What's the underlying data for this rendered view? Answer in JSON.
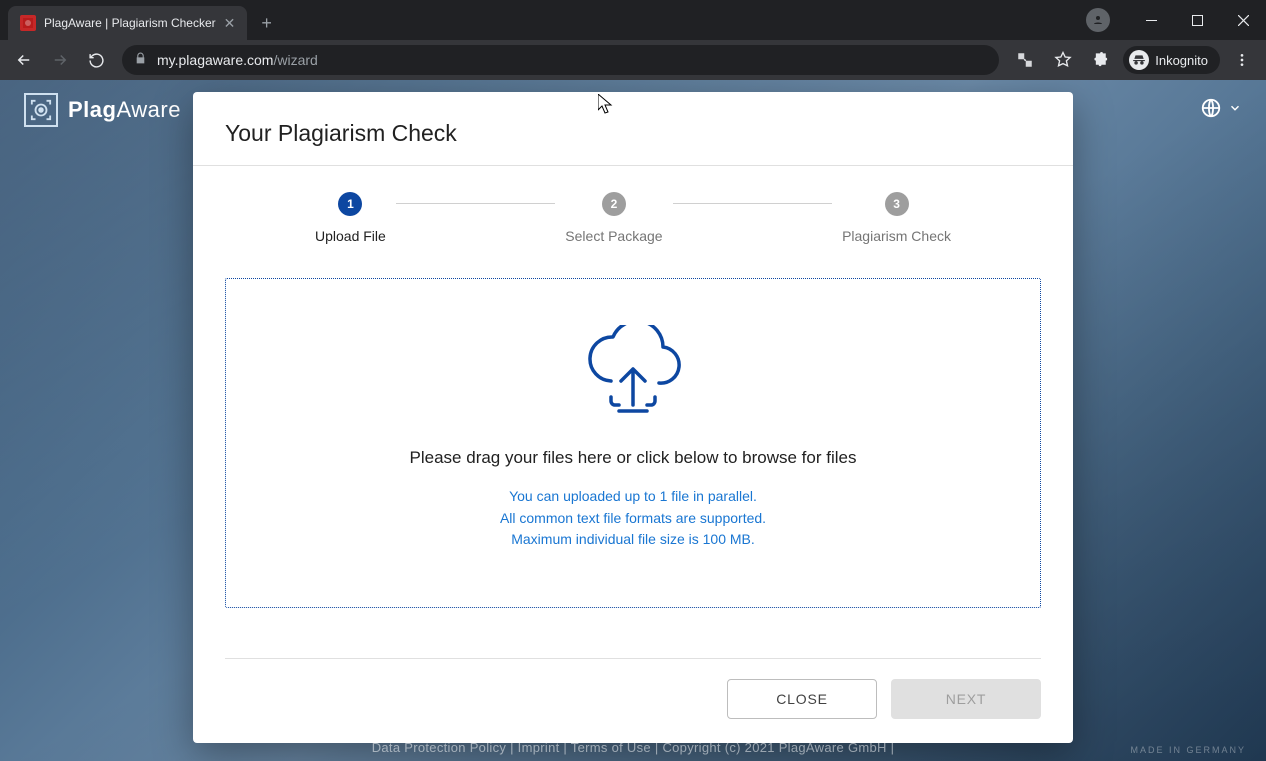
{
  "browser": {
    "tab_title": "PlagAware | Plagiarism Checker",
    "url_host": "my.plagaware.com",
    "url_path": "/wizard",
    "inkognito_label": "Inkognito"
  },
  "header": {
    "brand_a": "Plag",
    "brand_b": "Aware"
  },
  "card": {
    "title": "Your Plagiarism Check",
    "steps": [
      {
        "num": "1",
        "label": "Upload File",
        "active": true
      },
      {
        "num": "2",
        "label": "Select Package",
        "active": false
      },
      {
        "num": "3",
        "label": "Plagiarism Check",
        "active": false
      }
    ],
    "dropzone": {
      "main": "Please drag your files here or click below to browse for files",
      "sub1": "You can uploaded up to 1 file in parallel.",
      "sub2": "All common text file formats are supported.",
      "sub3": "Maximum individual file size is 100 MB."
    },
    "buttons": {
      "close": "CLOSE",
      "next": "NEXT"
    }
  },
  "footer": {
    "text": "Data Protection Policy  |  Imprint  |  Terms of Use  |  Copyright (c) 2021 PlagAware GmbH  |",
    "made": "MADE IN GERMANY"
  }
}
